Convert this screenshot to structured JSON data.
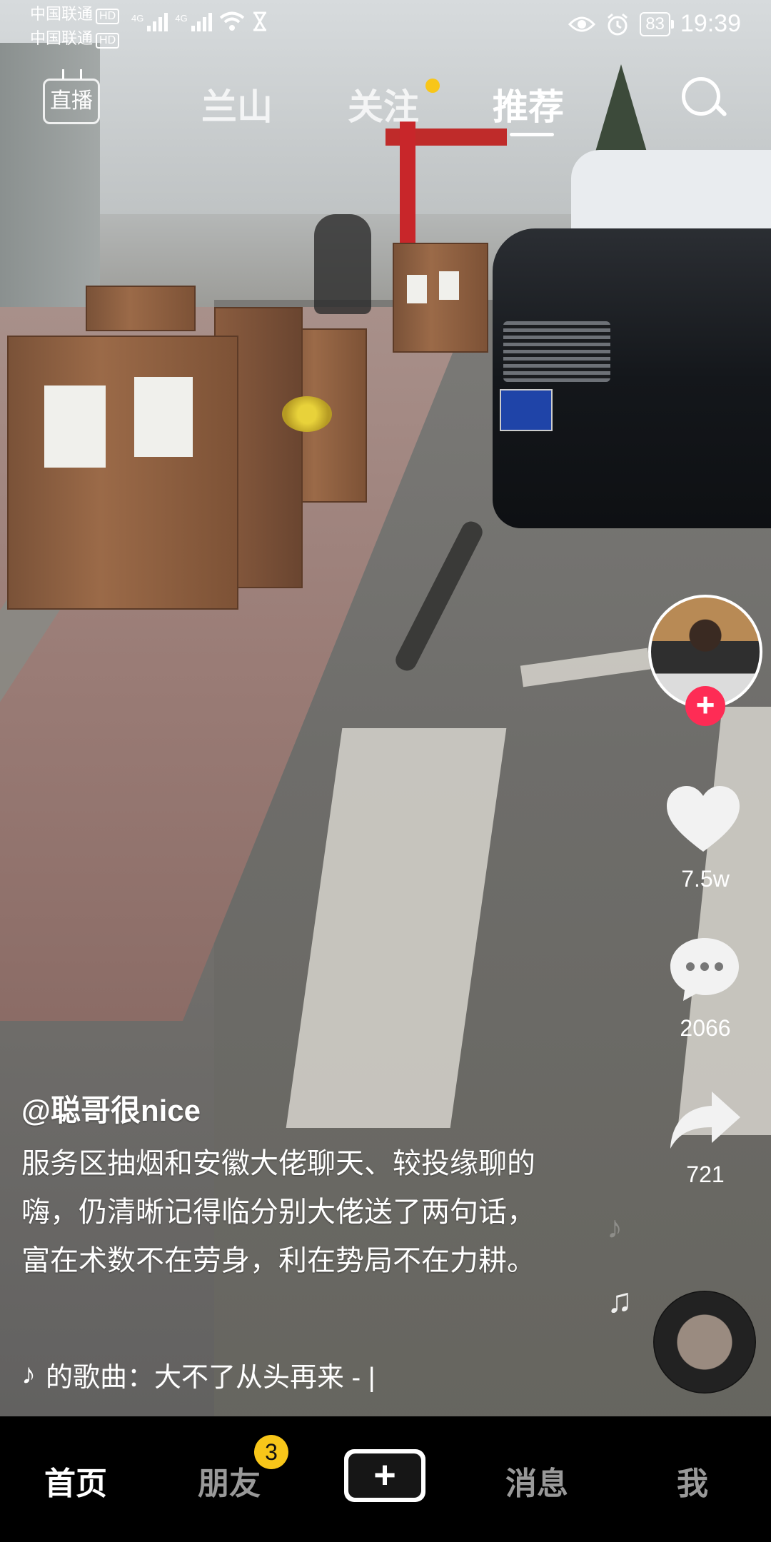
{
  "status_bar": {
    "carrier1": "中国联通",
    "carrier2": "中国联通",
    "hd": "HD",
    "network": "4G",
    "battery": "83",
    "time": "19:39"
  },
  "top_nav": {
    "live_label": "直播",
    "tabs": [
      {
        "label": "兰山"
      },
      {
        "label": "关注"
      },
      {
        "label": "推荐"
      }
    ],
    "active_tab": "推荐"
  },
  "actions": {
    "like_count": "7.5w",
    "comment_count": "2066",
    "share_count": "721"
  },
  "video": {
    "author": "@聪哥很nice",
    "description": "服务区抽烟和安徽大佬聊天、较投缘聊的嗨，仍清晰记得临分别大佬送了两句话，富在术数不在劳身，利在势局不在力耕。",
    "music": "的歌曲：大不了从头再来 - |"
  },
  "bottom_nav": {
    "home": "首页",
    "friends": "朋友",
    "friends_badge": "3",
    "create": "+",
    "messages": "消息",
    "me": "我"
  },
  "colors": {
    "accent_red": "#fe2c55",
    "accent_cyan": "#25f4ee",
    "badge_yellow": "#f8c619"
  }
}
